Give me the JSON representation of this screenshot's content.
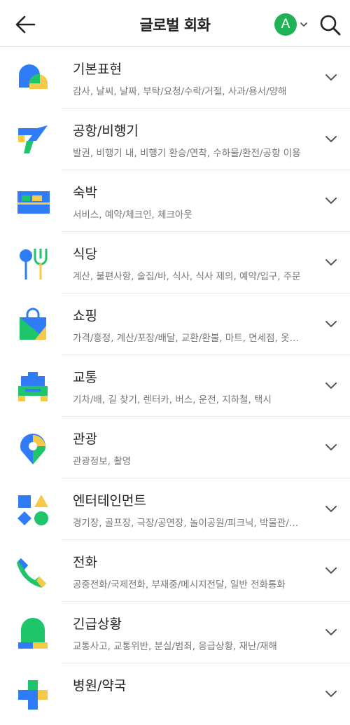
{
  "header": {
    "title": "글로벌 회화",
    "avatar_letter": "A",
    "back_icon": "arrow-left-icon",
    "search_icon": "search-icon",
    "accent": "#1fb257"
  },
  "categories": [
    {
      "name": "기본표현",
      "sub": "감사, 날씨, 날짜, 부탁/요청/수락/거절, 사과/용서/양해"
    },
    {
      "name": "공항/비행기",
      "sub": "발권, 비행기 내, 비행기 환승/연착, 수하물/환전/공항 이용"
    },
    {
      "name": "숙박",
      "sub": "서비스, 예약/체크인, 체크아웃"
    },
    {
      "name": "식당",
      "sub": "계산, 불편사항, 술집/바, 식사, 식사 제의, 예약/입구, 주문"
    },
    {
      "name": "쇼핑",
      "sub": "가격/흥정, 계산/포장/배달, 교환/환불, 마트, 면세점, 옷가게"
    },
    {
      "name": "교통",
      "sub": "기차/배, 길 찾기, 렌터카, 버스, 운전, 지하철, 택시"
    },
    {
      "name": "관광",
      "sub": "관광정보, 촬영"
    },
    {
      "name": "엔터테인먼트",
      "sub": "경기장, 골프장, 극장/공연장, 놀이공원/피크닉, 박물관/미술관"
    },
    {
      "name": "전화",
      "sub": "공중전화/국제전화, 부재중/메시지전달, 일반 전화통화"
    },
    {
      "name": "긴급상황",
      "sub": "교통사고, 교통위반, 분실/범죄, 응급상황, 재난/재해"
    },
    {
      "name": "병원/약국",
      "sub": ""
    }
  ]
}
